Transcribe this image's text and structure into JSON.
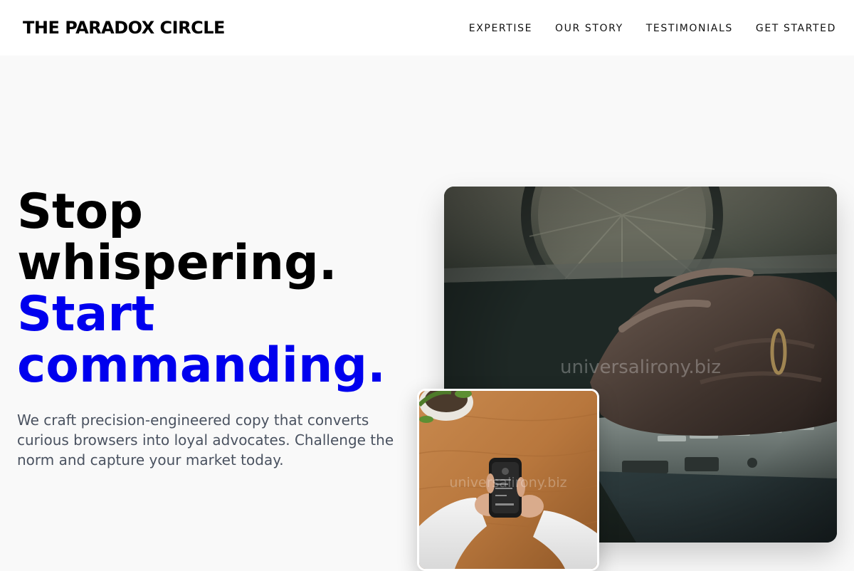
{
  "header": {
    "logo": "THE PARADOX CIRCLE",
    "nav": [
      {
        "label": "EXPERTISE"
      },
      {
        "label": "OUR STORY"
      },
      {
        "label": "TESTIMONIALS"
      },
      {
        "label": "GET STARTED"
      }
    ]
  },
  "hero": {
    "title_line1": "Stop",
    "title_line2": "whispering.",
    "title_line3": "Start",
    "title_line4": "commanding.",
    "description": "We craft precision-engineered copy that converts curious browsers into loyal advocates. Challenge the norm and capture your market today.",
    "accent_color": "#0000ee"
  },
  "images": {
    "main_watermark": "universalirony.biz",
    "small_watermark": "universalirony.biz"
  }
}
